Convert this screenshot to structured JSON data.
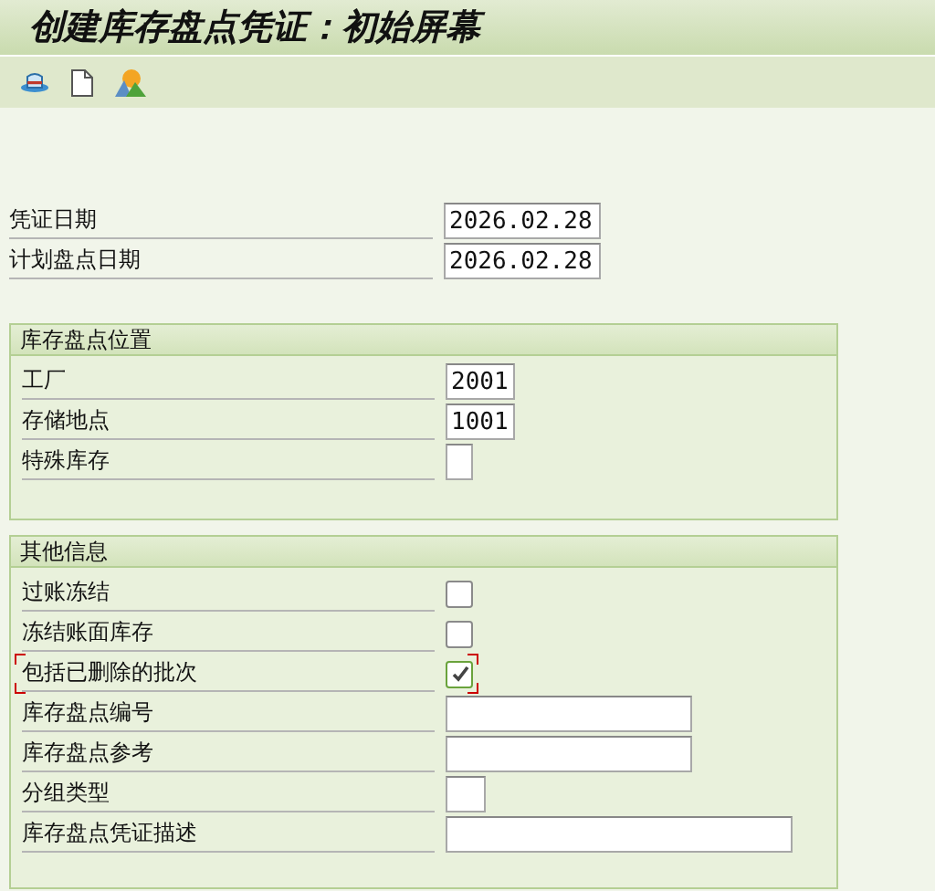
{
  "window": {
    "title": "创建库存盘点凭证：初始屏幕"
  },
  "toolbar": [
    {
      "kind": "hat"
    },
    {
      "kind": "page"
    },
    {
      "kind": "mountain"
    }
  ],
  "header_fields": [
    {
      "label": "凭证日期",
      "kind": "date",
      "value": "2026.02.28"
    },
    {
      "label": "计划盘点日期",
      "kind": "date",
      "value": "2026.02.28"
    }
  ],
  "groups": [
    {
      "title": "库存盘点位置",
      "fields": [
        {
          "label": "工厂",
          "kind": "code",
          "value": "2001"
        },
        {
          "label": "存储地点",
          "kind": "code",
          "value": "1001"
        },
        {
          "label": "特殊库存",
          "kind": "flag"
        }
      ]
    },
    {
      "title": "其他信息",
      "fields": [
        {
          "label": "过账冻结",
          "kind": "checkbox",
          "checked": false,
          "focused": false
        },
        {
          "label": "冻结账面库存",
          "kind": "checkbox",
          "checked": false,
          "focused": false
        },
        {
          "label": "包括已删除的批次",
          "kind": "checkbox",
          "checked": true,
          "focused": true
        },
        {
          "label": "库存盘点编号",
          "kind": "text"
        },
        {
          "label": "库存盘点参考",
          "kind": "text"
        },
        {
          "label": "分组类型",
          "kind": "short"
        },
        {
          "label": "库存盘点凭证描述",
          "kind": "long"
        }
      ]
    }
  ]
}
